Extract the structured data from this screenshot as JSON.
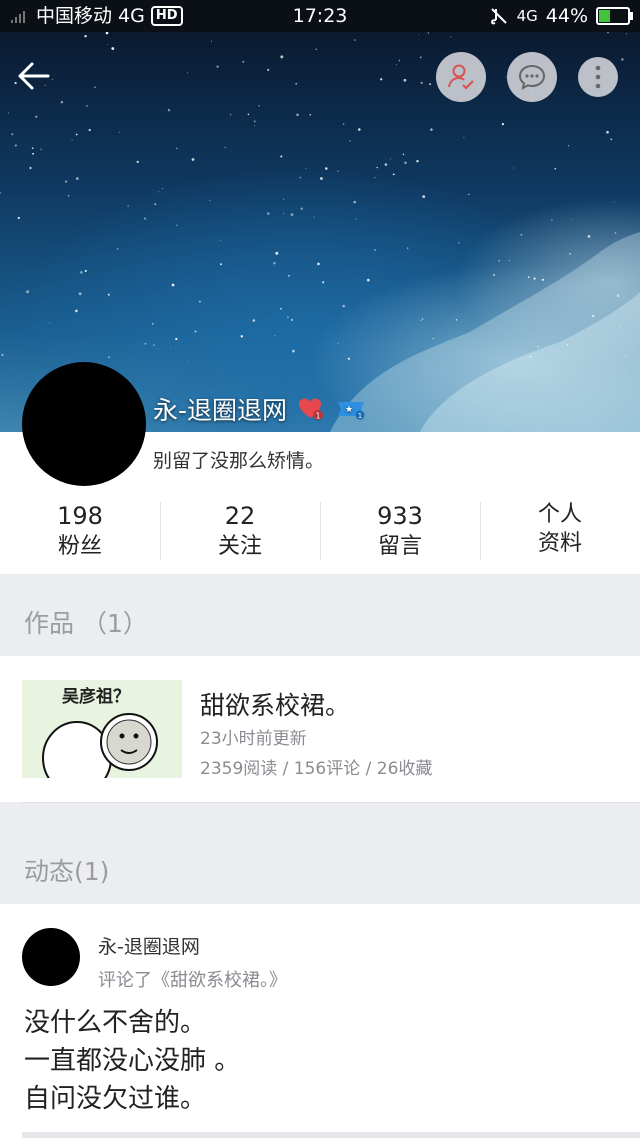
{
  "status_bar": {
    "carrier": "中国移动 4G",
    "hd": "HD",
    "time": "17:23",
    "network": "4G",
    "battery": "44%",
    "battery_level": 0.44
  },
  "profile": {
    "username": "永-退圈退网",
    "signature": "别留了没那么矫情。",
    "heart_badge_count": "1",
    "level_badge_text": "1"
  },
  "stats": [
    {
      "num": "198",
      "label": "粉丝"
    },
    {
      "num": "22",
      "label": "关注"
    },
    {
      "num": "933",
      "label": "留言"
    },
    {
      "label1": "个人",
      "label2": "资料"
    }
  ],
  "works": {
    "section_title": "作品 （1）",
    "item": {
      "thumb_text": "吴彦祖？",
      "title": "甜欲系校裙。",
      "updated": "23小时前更新",
      "meta": "2359阅读 / 156评论 / 26收藏"
    }
  },
  "feed": {
    "section_title": "动态(1)",
    "item": {
      "name": "永-退圈退网",
      "action": "评论了《甜欲系校裙。》",
      "lines": [
        "没什么不舍的。",
        "一直都没心没肺 。",
        "自问没欠过谁。"
      ]
    }
  },
  "icons": {
    "back": "arrow-left-icon",
    "follow": "user-check-icon",
    "message": "chat-bubble-icon",
    "more": "more-vertical-icon"
  },
  "colors": {
    "accent_red": "#e8474d",
    "level_blue": "#2f8fe0"
  }
}
